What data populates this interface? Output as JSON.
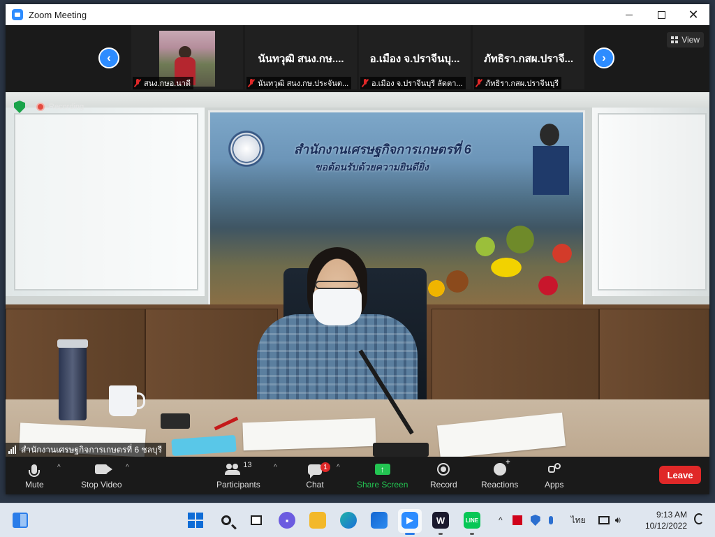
{
  "window": {
    "title": "Zoom Meeting"
  },
  "strip": {
    "view_label": "View",
    "tiles": [
      {
        "name": "",
        "label": "สนง.กษอ.นาดี",
        "has_photo": true
      },
      {
        "name": "นันทวุฒิ สนง.กษ....",
        "label": "นันทวุฒิ สนง.กษ.ประจันต..."
      },
      {
        "name": "อ.เมือง จ.ปราจีนบุ...",
        "label": "อ.เมือง จ.ปราจีนบุรี ลัดตา..."
      },
      {
        "name": "ภัทธิรา.กสผ.ปราจี...",
        "label": "ภัทธิรา.กสผ.ปราจีนบุรี"
      }
    ]
  },
  "video": {
    "recording_label": "Recording",
    "speaker_name": "สำนักงานเศรษฐกิจการเกษตรที่ 6 ชลบุรี",
    "banner_line1": "สำนักงานเศรษฐกิจการเกษตรที่ 6",
    "banner_line2": "ขอต้อนรับด้วยความยินดียิ่ง"
  },
  "controls": {
    "mute": "Mute",
    "stop_video": "Stop Video",
    "participants": "Participants",
    "participants_count": "13",
    "chat": "Chat",
    "chat_badge": "1",
    "share_screen": "Share Screen",
    "record": "Record",
    "reactions": "Reactions",
    "apps": "Apps",
    "leave": "Leave"
  },
  "taskbar": {
    "language": "ไทย",
    "time": "9:13 AM",
    "date": "10/12/2022"
  },
  "colors": {
    "zoom_blue": "#2d8cff",
    "share_green": "#23c552",
    "leave_red": "#e02828",
    "control_bar_bg": "#1a1a1a"
  }
}
